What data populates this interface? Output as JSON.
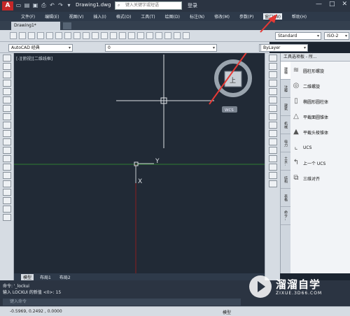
{
  "titlebar": {
    "app_letter": "A",
    "document": "Drawing1.dwg",
    "search_placeholder": "键入关键字或短语",
    "login": "登录",
    "window_buttons": [
      "—",
      "□",
      "✕"
    ]
  },
  "menu": {
    "items": [
      "文件(F)",
      "编辑(E)",
      "视图(V)",
      "插入(I)",
      "格式(O)",
      "工具(T)",
      "绘图(D)",
      "标注(N)",
      "修改(M)",
      "参数(P)",
      "窗口(W)",
      "帮助(H)"
    ]
  },
  "tabs": {
    "document_tab": "Drawing1*"
  },
  "toolbar": {
    "textstyle": "Standard",
    "dimstyle": "ISO-2",
    "workspace": "AutoCAD 经典",
    "layer": "0",
    "linetype": "ByLayer"
  },
  "canvas": {
    "view_label": "[-][俯视][二维线框]",
    "viewcube_face": "上",
    "wcs_label": "WCS",
    "ucs_y": "Y",
    "ucs_x": "X"
  },
  "palette": {
    "title": "工具选项板 - 所...",
    "tabs": [
      "建模",
      "注释",
      "建筑",
      "机械",
      "电力",
      "土木..",
      "结构",
      "表格",
      "命令..."
    ],
    "items": [
      {
        "label": "圆柱形螺旋",
        "icon": "spring-icon"
      },
      {
        "label": "二维螺旋",
        "icon": "spiral-icon"
      },
      {
        "label": "椭圆形圆柱体",
        "icon": "cylinder-icon"
      },
      {
        "label": "平截面圆锥体",
        "icon": "cone-icon"
      },
      {
        "label": "平截头棱锥体",
        "icon": "pyramid-icon"
      },
      {
        "label": "UCS",
        "icon": "ucs-icon"
      },
      {
        "label": "上一个 UCS",
        "icon": "ucs-previous-icon"
      },
      {
        "label": "三维对齐",
        "icon": "align-icon"
      }
    ]
  },
  "layout_tabs": [
    "模型",
    "布局1",
    "布局2"
  ],
  "command": {
    "line1": "命令: '_lockui",
    "line2": "输入 LOCKUI 的新值 <0>: 15",
    "placeholder": "键入命令"
  },
  "status": {
    "coords": "-0.5969, 0.2492 , 0.0000",
    "model_label": "模型"
  },
  "watermark": {
    "text": "溜溜自学",
    "sub": "ZIXUE.3D66.COM"
  },
  "colors": {
    "canvas_bg": "#212a36",
    "arrow": "#e53935",
    "x_axis": "#c62828",
    "y_axis": "#2e7d32"
  }
}
